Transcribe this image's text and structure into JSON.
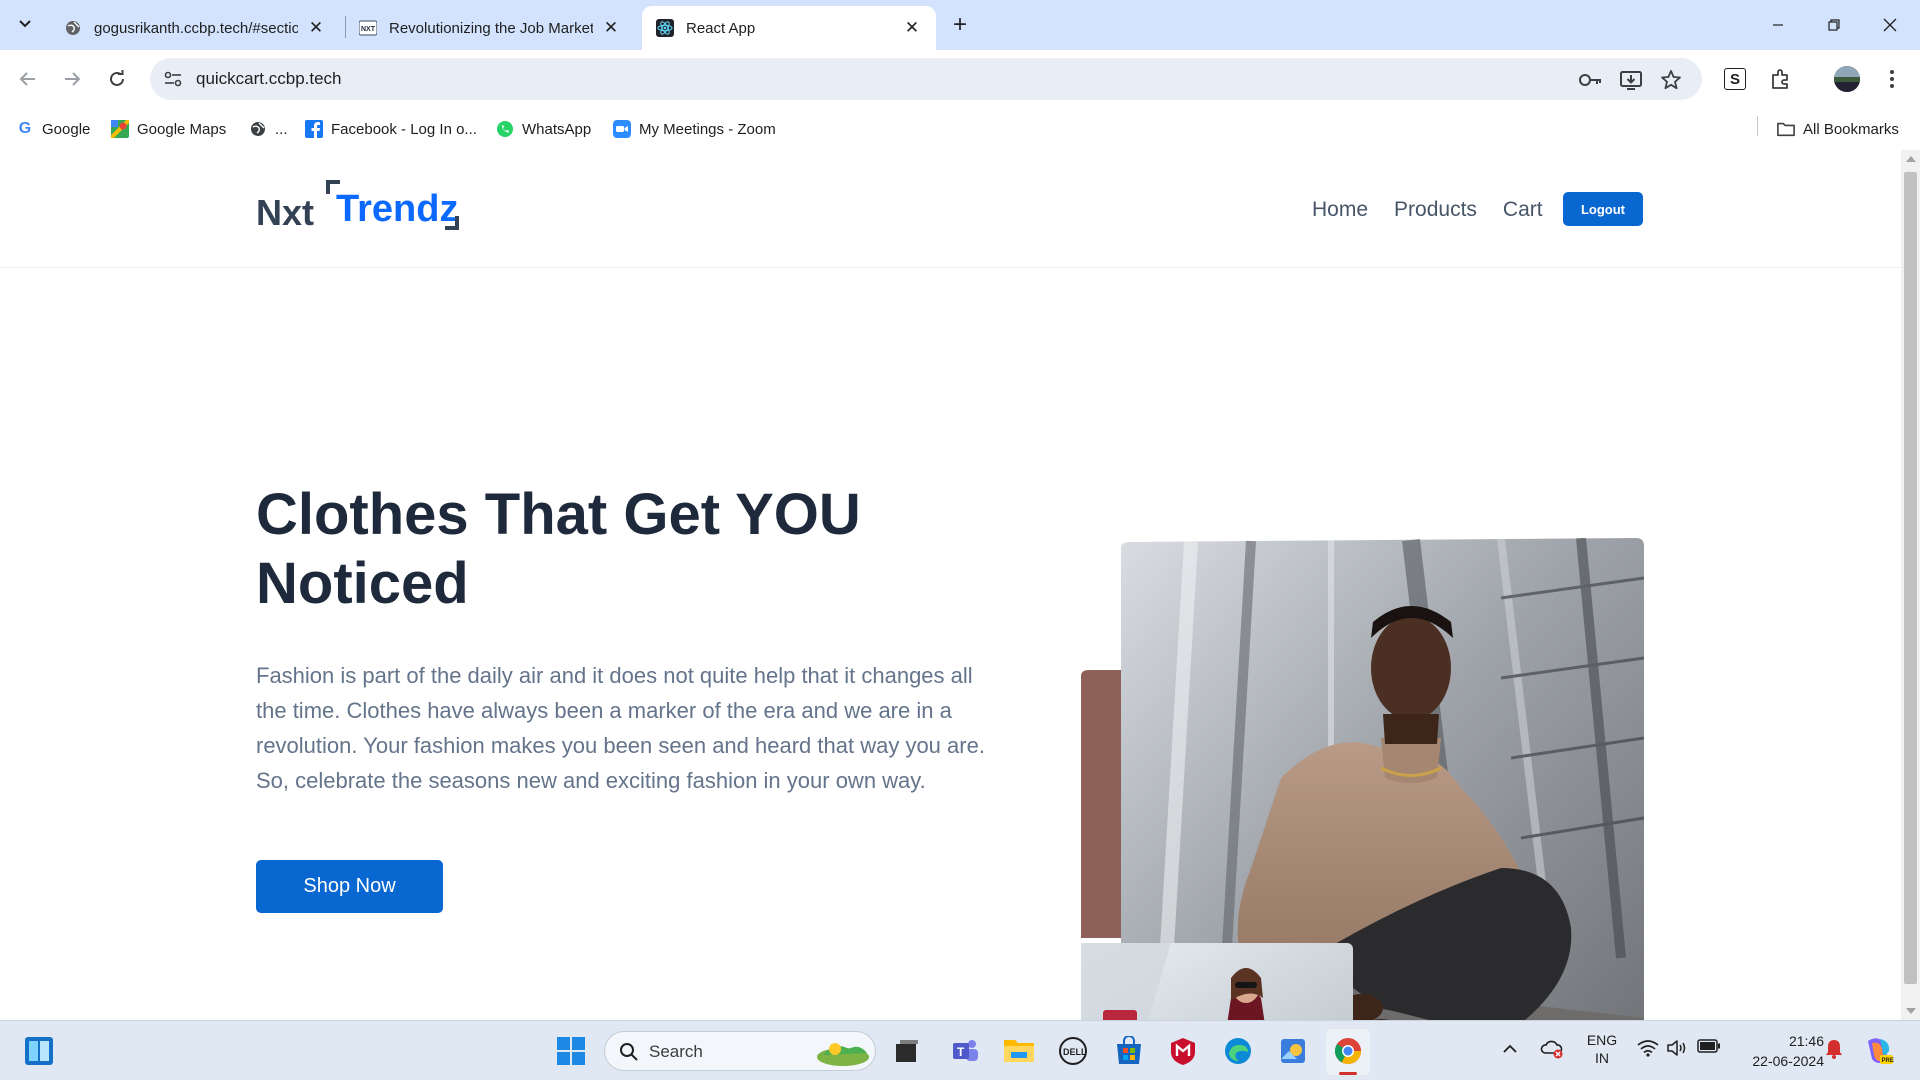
{
  "browser": {
    "tabs": [
      {
        "title": "gogusrikanth.ccbp.tech/#sectio",
        "icon": "globe-icon",
        "active": false
      },
      {
        "title": "Revolutionizing the Job Market",
        "icon": "nxtwave-icon",
        "active": false
      },
      {
        "title": "React App",
        "icon": "react-icon",
        "active": true
      }
    ],
    "url": "quickcart.ccbp.tech",
    "profile_extension_letter": "S",
    "bookmarks": [
      {
        "label": "Google",
        "icon": "google-icon"
      },
      {
        "label": "Google Maps",
        "icon": "maps-icon"
      },
      {
        "label": "...",
        "icon": "globe-icon"
      },
      {
        "label": "Facebook - Log In o...",
        "icon": "facebook-icon"
      },
      {
        "label": "WhatsApp",
        "icon": "whatsapp-icon"
      },
      {
        "label": "My Meetings - Zoom",
        "icon": "zoom-icon"
      }
    ],
    "all_bookmarks": "All Bookmarks"
  },
  "site": {
    "logo_prefix": "Nxt",
    "logo_brand": "Trendz",
    "nav": {
      "home": "Home",
      "products": "Products",
      "cart": "Cart",
      "logout": "Logout"
    },
    "hero": {
      "heading": "Clothes That Get YOU Noticed",
      "description": "Fashion is part of the daily air and it does not quite help that it changes all the time. Clothes have always been a marker of the era and we are in a revolution. Your fashion makes you been seen and heard that way you are. So, celebrate the seasons new and exciting fashion in your own way.",
      "cta": "Shop Now"
    }
  },
  "taskbar": {
    "search_placeholder": "Search",
    "language": "ENG",
    "region": "IN",
    "time": "21:46",
    "date": "22-06-2024"
  },
  "colors": {
    "brand_blue": "#0b69ff",
    "button_blue": "#0967d2",
    "heading": "#1e293b",
    "body_text": "#64748b",
    "accent_panel": "#8d6157"
  }
}
